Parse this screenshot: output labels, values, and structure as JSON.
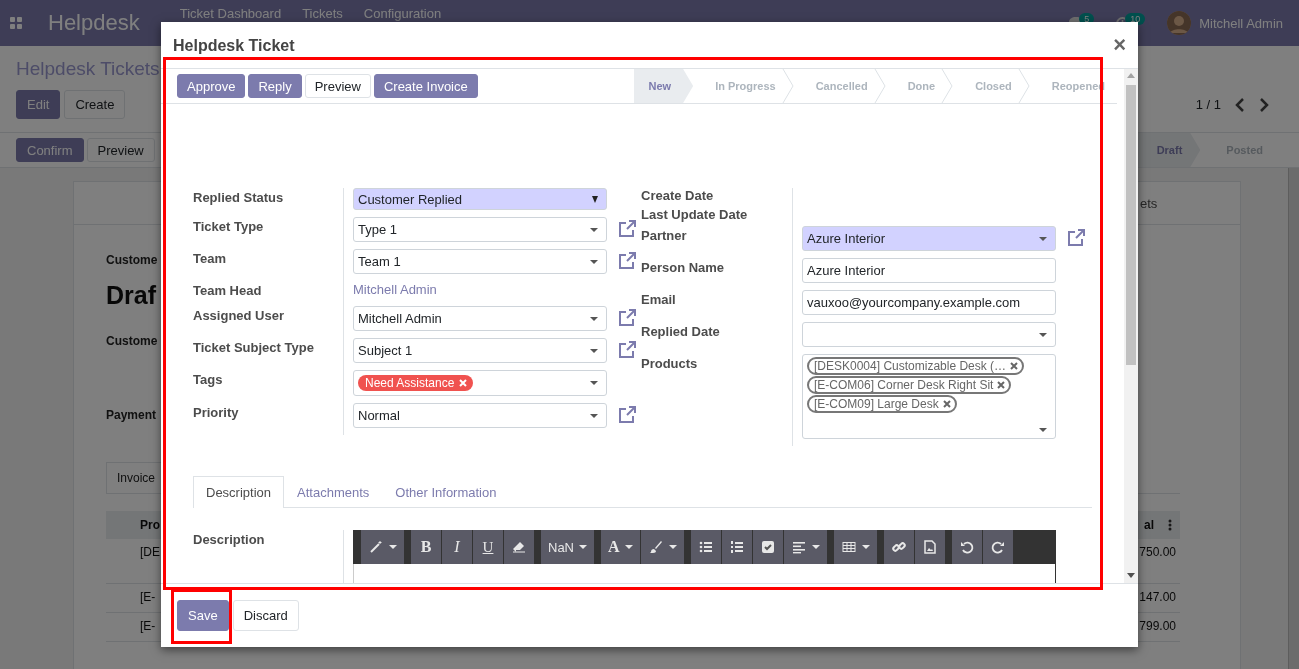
{
  "navbar": {
    "app_name": "Helpdesk",
    "menu": [
      "Ticket Dashboard",
      "Tickets",
      "Configuration"
    ],
    "messages_count": "5",
    "activities_count": "10",
    "user": "Mitchell Admin"
  },
  "background": {
    "breadcrumb": "Helpdesk Tickets",
    "buttons": [
      {
        "label": "Edit",
        "kind": "primary"
      },
      {
        "label": "Create",
        "kind": "secondary"
      }
    ],
    "pager": "1 / 1",
    "actions": [
      {
        "label": "Confirm",
        "kind": "primary"
      },
      {
        "label": "Preview",
        "kind": "secondary"
      }
    ],
    "stages": [
      {
        "label": "Draft",
        "selected": true
      },
      {
        "label": "Posted",
        "selected": false
      }
    ],
    "sheet_button": "ets",
    "sheet_items": [
      {
        "kind": "label",
        "text": "Custome"
      },
      {
        "kind": "title",
        "text": "Draf"
      },
      {
        "kind": "label",
        "text": "Custome"
      },
      {
        "kind": "label",
        "text": "Payment"
      }
    ],
    "tab": "Invoice",
    "table": {
      "columns": [
        "Pro",
        "al"
      ],
      "rows": [
        [
          "[DE",
          "750.00"
        ],
        [
          "[E-",
          "147.00"
        ],
        [
          "[E-",
          "799.00"
        ]
      ]
    }
  },
  "dialog": {
    "title": "Helpdesk Ticket",
    "close": "×",
    "header_buttons": [
      {
        "label": "Approve",
        "kind": "primary"
      },
      {
        "label": "Reply",
        "kind": "primary"
      },
      {
        "label": "Preview",
        "kind": "secondary"
      },
      {
        "label": "Create Invoice",
        "kind": "primary"
      }
    ],
    "stages": [
      {
        "label": "New",
        "selected": true
      },
      {
        "label": "In Progress",
        "selected": false
      },
      {
        "label": "Cancelled",
        "selected": false
      },
      {
        "label": "Done",
        "selected": false
      },
      {
        "label": "Closed",
        "selected": false
      },
      {
        "label": "Reopened",
        "selected": false
      }
    ],
    "left_fields": [
      {
        "label": "Replied Status",
        "kind": "selection",
        "value": "Customer Replied",
        "required": true,
        "external_link": false
      },
      {
        "label": "Ticket Type",
        "kind": "many2one",
        "value": "Type 1",
        "required": false,
        "external_link": true
      },
      {
        "label": "Team",
        "kind": "many2one",
        "value": "Team 1",
        "required": false,
        "external_link": true
      },
      {
        "label": "Team Head",
        "kind": "link",
        "value": "Mitchell Admin",
        "external_link": false
      },
      {
        "label": "Assigned User",
        "kind": "many2one",
        "value": "Mitchell Admin",
        "required": false,
        "external_link": true
      },
      {
        "label": "Ticket Subject Type",
        "kind": "many2one",
        "value": "Subject 1",
        "required": false,
        "external_link": true
      },
      {
        "label": "Tags",
        "kind": "tags",
        "tags": [
          "Need Assistance"
        ],
        "required": false,
        "external_link": false
      },
      {
        "label": "Priority",
        "kind": "many2one",
        "value": "Normal",
        "required": false,
        "external_link": true
      }
    ],
    "right_fields": [
      {
        "label": "Create Date",
        "kind": "empty",
        "external_link": false
      },
      {
        "label": "Last Update Date",
        "kind": "empty",
        "external_link": false
      },
      {
        "label": "Partner",
        "kind": "many2one",
        "value": "Azure Interior",
        "required": true,
        "external_link": true
      },
      {
        "label": "Person Name",
        "kind": "text",
        "value": "Azure Interior",
        "required": false,
        "external_link": false
      },
      {
        "label": "Email",
        "kind": "text",
        "value": "vauxoo@yourcompany.example.com",
        "required": false,
        "external_link": false
      },
      {
        "label": "Replied Date",
        "kind": "date",
        "required": false,
        "external_link": false
      },
      {
        "label": "Products",
        "kind": "product_tags",
        "tags": [
          "[DESK0004] Customizable Desk (…",
          "[E-COM06] Corner Desk Right Sit",
          "[E-COM09] Large Desk"
        ],
        "required": false,
        "external_link": false
      }
    ],
    "tabs": [
      {
        "label": "Description",
        "selected": true
      },
      {
        "label": "Attachments",
        "selected": false
      },
      {
        "label": "Other Information",
        "selected": false
      }
    ],
    "description_label": "Description",
    "editor_toolbar_labels": [
      "B",
      "I",
      "U",
      "NaN",
      "A"
    ],
    "footer_buttons": [
      {
        "label": "Save",
        "kind": "primary"
      },
      {
        "label": "Discard",
        "kind": "secondary"
      }
    ]
  }
}
